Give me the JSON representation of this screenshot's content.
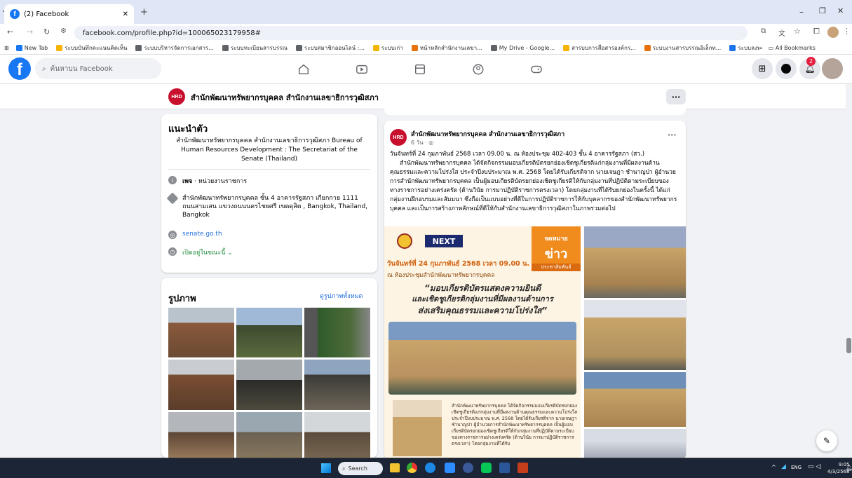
{
  "browser": {
    "tab_title": "(2) Facebook",
    "url": "facebook.com/profile.php?id=100065023179958#",
    "bookmarks": [
      "New Tab",
      "ระบบบันทึกคะแนนคิดเห็น",
      "ระบบบริหารจัดการเอกสาร...",
      "ระบบทะเบียนสารบรรณ",
      "ระบบสมาชิกออนไลน์ :...",
      "ระบบเก่า",
      "หน้าหลักสำนักงานเลขา...",
      "My Drive - Google...",
      "สารบบการสื่อสารองค์กร...",
      "ระบบงานสารบรรณอิเล็กท...",
      "ระบบลงทะเบียนออนไลน์",
      "ระบบทะเบียนประวัติบุคล..."
    ],
    "all_bookmarks": "All Bookmarks"
  },
  "fb": {
    "search_placeholder": "ค้นหาบน Facebook",
    "notif_count": "2"
  },
  "page": {
    "name": "สำนักพัฒนาทรัพยากรบุคคล สำนักงานเลขาธิการวุฒิสภา",
    "more": "···",
    "logo_text": "HRD"
  },
  "intro": {
    "heading": "แนะนำตัว",
    "desc": "สำนักพัฒนาทรัพยากรบุคคล สำนักงานเลขาธิการวุฒิสภา Bureau of Human Resources Development : The Secretariat of the Senate (Thailand)",
    "category_bold": "เพจ",
    "category": " · หน่วยงานราชการ",
    "address": "สำนักพัฒนาทรัพยากรบุคคล ชั้น 4 อาคารรัฐสภา เกียกกาย 1111 ถนนสามเสน แขวงถนนนครไชยศรี เขตดุสิต , Bangkok, Thailand, Bangkok",
    "website": "senate.go.th",
    "hours": "เปิดอยู่ในขณะนี้"
  },
  "photos": {
    "heading": "รูปภาพ",
    "see_all": "ดูรูปภาพทั้งหมด"
  },
  "post": {
    "author": "สำนักพัฒนาทรัพยากรบุคคล สำนักงานเลขาธิการวุฒิสภา",
    "time": "6 วัน · ",
    "more": "···",
    "line1": "วันจันทร์ที่ 24 กุมภาพันธ์ 2568 เวลา 09.00 น. ณ ห้องประชุม 402-403 ชั้น 4 อาคารรัฐสภา (สว.)",
    "body": "สำนักพัฒนาทรัพยากรบุคคล ได้จัดกิจกรรมมอบเกียรติบัตรยกย่องเชิดชูเกียรติแก่กลุ่มงานที่มีผลงานด้านคุณธรรมและความโปร่งใส ประจำปีงบประมาณ พ.ศ. 2568 โดยได้รับเกียรติจาก นายเจษฎา ชำนาญป่า ผู้อำนวยการสำนักพัฒนาทรัพยากรบุคคล เป็นผู้มอบเกียรติบัตรยกย่องเชิดชูเกียรติให้กับกลุ่มงานที่ปฏิบัติตามระเบียบของทางราชการอย่างเคร่งครัด (ด้านวินัย การมาปฏิบัติราชการตรงเวลา) โดยกลุ่มงานที่ได้รับยกย่องในครั้งนี้ ได้แก่ กลุ่มงานฝึกอบรมและสัมมนา ซึ่งถือเป็นแบบอย่างที่ดีในการปฏิบัติราชการให้กับบุคลากรของสำนักพัฒนาทรัพยากรบุคคล และเป็นการสร้างภาพลักษณ์ที่ดีให้กับสำนักงานเลขาธิการวุฒิสภาในภาพรวมต่อไป",
    "poster": {
      "badge1": "จดหมาย",
      "badge2": "ข่าว",
      "badge3": "ประชาสัมพันธ์",
      "next": "NEXT",
      "date": "วันจันทร์ที่ 24 กุมภาพันธ์ 2568 เวลา 09.00 น.",
      "place": "ณ ห้องประชุมสำนักพัฒนาทรัพยากรบุคคล",
      "headline1": "“มอบเกียรติบัตรแสดงความยินดี",
      "headline2": "และเชิดชูเกียรติกลุ่มงานที่มีผลงานด้านการ",
      "headline3": "ส่งเสริมคุณธรรมและความโปร่งใส”",
      "small": "สำนักพัฒนาทรัพยากรบุคคล ได้จัดกิจกรรมมอบเกียรติบัตรยกย่องเชิดชูเกียรติแก่กลุ่มงานที่มีผลงานด้านคุณธรรมและความโปร่งใส ประจำปีงบประมาณ พ.ศ. 2568 โดยได้รับเกียรติจาก นายเจษฎา ชำนาญป่า ผู้อำนวยการสำนักพัฒนาทรัพยากรบุคคล เป็นผู้มอบเกียรติบัตรยกย่องเชิดชูเกียรติให้กับกลุ่มงานที่ปฏิบัติตามระเบียบของทางราชการอย่างเคร่งครัด (ด้านวินัย การมาปฏิบัติราชการตรงเวลา) โดยกลุ่มงานที่ได้รับ"
    }
  },
  "taskbar": {
    "search": "Search",
    "lang": "ENG",
    "time": "9:05",
    "date": "4/3/2568"
  },
  "colors": {
    "fb_blue": "#1877f2",
    "hrd_red": "#c8102e",
    "poster_orange": "#f08c1e"
  }
}
